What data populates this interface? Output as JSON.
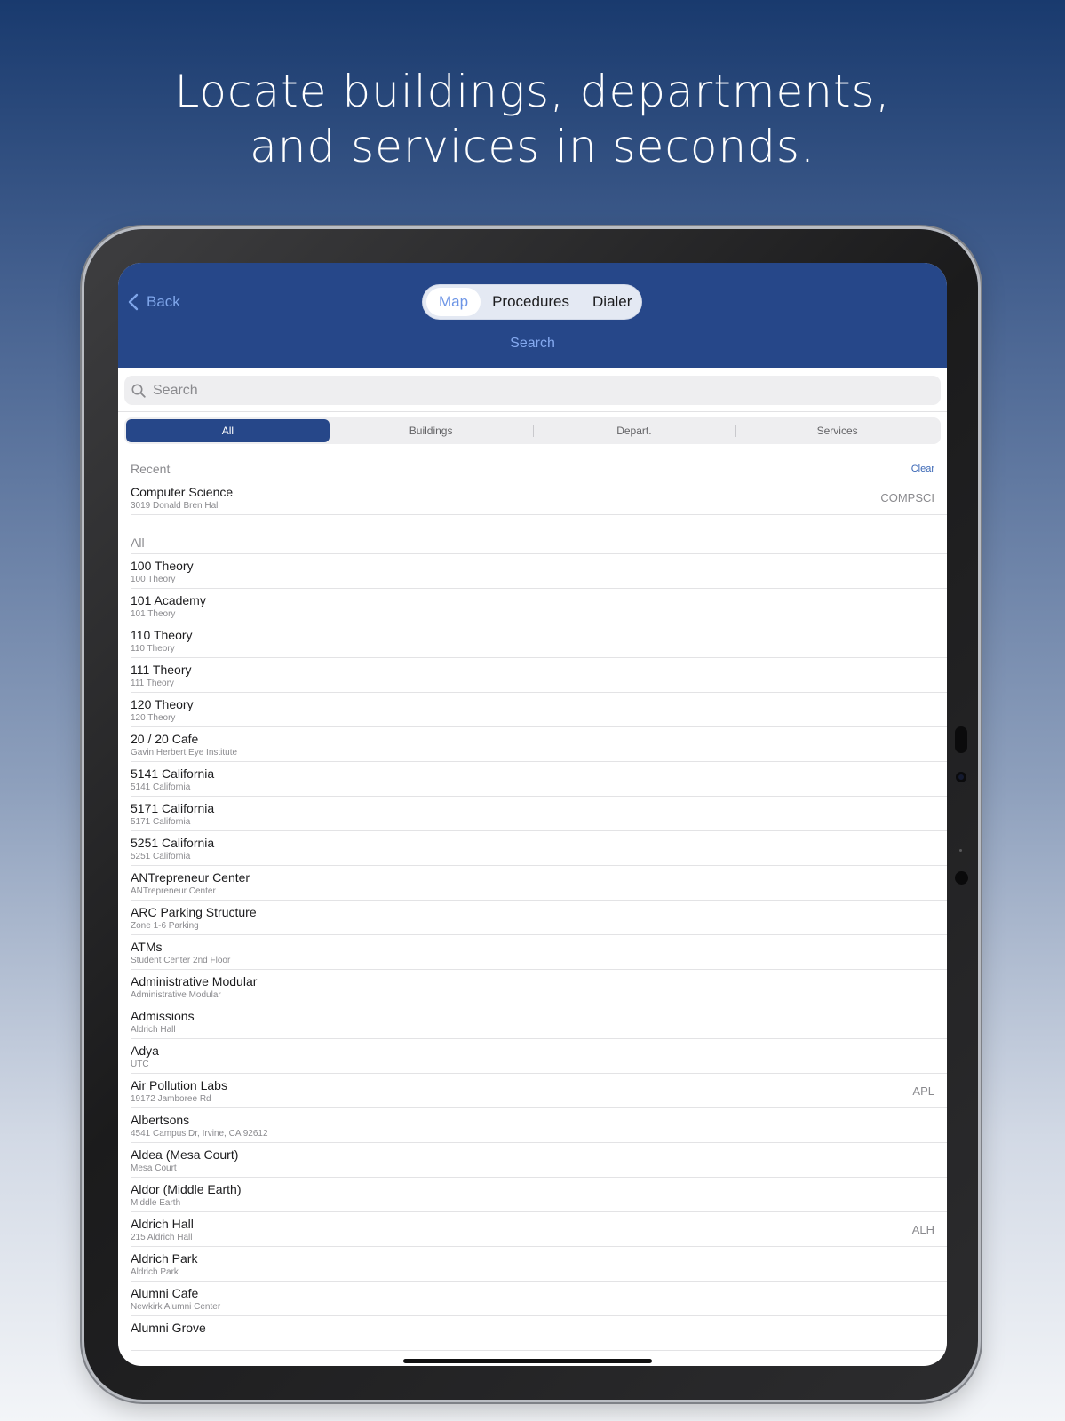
{
  "headline": {
    "line1": "Locate buildings, departments,",
    "line2": "and services in seconds."
  },
  "navbar": {
    "back_label": "Back",
    "tabs": [
      {
        "label": "Map",
        "active": true
      },
      {
        "label": "Procedures",
        "active": false
      },
      {
        "label": "Dialer",
        "active": false
      }
    ],
    "title": "Search"
  },
  "search": {
    "placeholder": "Search",
    "value": ""
  },
  "filters": [
    {
      "label": "All",
      "active": true
    },
    {
      "label": "Buildings",
      "active": false
    },
    {
      "label": "Depart.",
      "active": false
    },
    {
      "label": "Services",
      "active": false
    }
  ],
  "recent": {
    "header": "Recent",
    "clear_label": "Clear",
    "items": [
      {
        "title": "Computer Science",
        "subtitle": "3019 Donald Bren Hall",
        "code": "COMPSCI"
      }
    ]
  },
  "all": {
    "header": "All",
    "items": [
      {
        "title": "100 Theory",
        "subtitle": "100 Theory",
        "code": ""
      },
      {
        "title": "101 Academy",
        "subtitle": "101 Theory",
        "code": ""
      },
      {
        "title": "110 Theory",
        "subtitle": "110 Theory",
        "code": ""
      },
      {
        "title": "111 Theory",
        "subtitle": "111 Theory",
        "code": ""
      },
      {
        "title": "120 Theory",
        "subtitle": "120 Theory",
        "code": ""
      },
      {
        "title": "20 / 20 Cafe",
        "subtitle": "Gavin Herbert Eye Institute",
        "code": ""
      },
      {
        "title": "5141 California",
        "subtitle": "5141 California",
        "code": ""
      },
      {
        "title": "5171 California",
        "subtitle": "5171 California",
        "code": ""
      },
      {
        "title": "5251 California",
        "subtitle": "5251 California",
        "code": ""
      },
      {
        "title": "ANTrepreneur Center",
        "subtitle": "ANTrepreneur Center",
        "code": ""
      },
      {
        "title": "ARC Parking Structure",
        "subtitle": "Zone 1-6 Parking",
        "code": ""
      },
      {
        "title": "ATMs",
        "subtitle": "Student Center 2nd Floor",
        "code": ""
      },
      {
        "title": "Administrative Modular",
        "subtitle": "Administrative Modular",
        "code": ""
      },
      {
        "title": "Admissions",
        "subtitle": "Aldrich Hall",
        "code": ""
      },
      {
        "title": "Adya",
        "subtitle": "UTC",
        "code": ""
      },
      {
        "title": "Air Pollution Labs",
        "subtitle": "19172 Jamboree Rd",
        "code": "APL"
      },
      {
        "title": "Albertsons",
        "subtitle": "4541 Campus Dr, Irvine, CA 92612",
        "code": ""
      },
      {
        "title": "Aldea (Mesa Court)",
        "subtitle": "Mesa Court",
        "code": ""
      },
      {
        "title": "Aldor (Middle Earth)",
        "subtitle": "Middle Earth",
        "code": ""
      },
      {
        "title": "Aldrich Hall",
        "subtitle": "215 Aldrich Hall",
        "code": "ALH"
      },
      {
        "title": "Aldrich Park",
        "subtitle": "Aldrich Park",
        "code": ""
      },
      {
        "title": "Alumni Cafe",
        "subtitle": "Newkirk Alumni Center",
        "code": ""
      },
      {
        "title": "Alumni Grove",
        "subtitle": "",
        "code": ""
      }
    ]
  },
  "colors": {
    "navbar": "#264789",
    "accent": "#7fa6ea",
    "filter_active": "#264789"
  }
}
